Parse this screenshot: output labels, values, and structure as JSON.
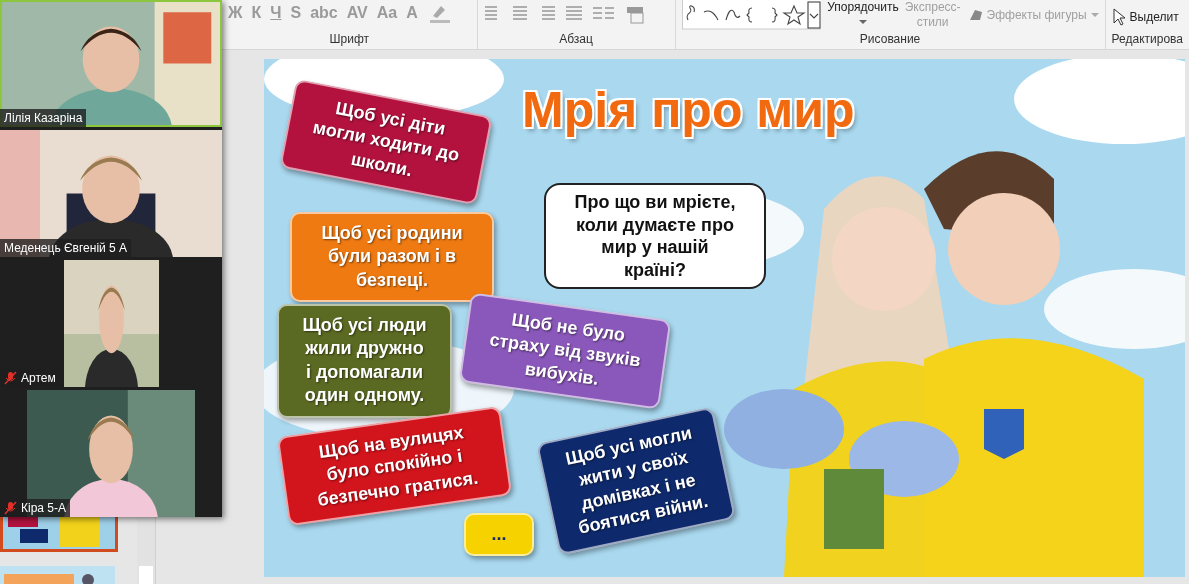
{
  "ribbon": {
    "font_tools": [
      "Ж",
      "К",
      "Ч",
      "S",
      "abc",
      "AV",
      "Aa",
      "A"
    ],
    "font_label": "Шрифт",
    "paragraph_label": "Абзац",
    "arrange_button": "Упорядочить",
    "quick_styles": [
      "Экспресс-",
      "стили"
    ],
    "shape_effects": "Эффекты фигуры",
    "drawing_label": "Рисование",
    "select_button": "Выделит",
    "editing_label": "Редактирова"
  },
  "video_call": {
    "participants": [
      {
        "name": "Лілія Казаріна",
        "muted": false,
        "speaking": true
      },
      {
        "name": "Меденець Євгеній 5 А",
        "muted": false,
        "speaking": false
      },
      {
        "name": "Артем",
        "muted": true,
        "speaking": false
      },
      {
        "name": "Кіра 5-А",
        "muted": true,
        "speaking": false
      }
    ]
  },
  "slide": {
    "title": "Мрія про мир",
    "question": [
      "Про що ви мрієте,",
      "коли думаєте про",
      "мир у нашій",
      "країні?"
    ],
    "cards": [
      {
        "lines": [
          "Щоб усі діти",
          "могли ходити до",
          "школи."
        ],
        "color": "#b3123e"
      },
      {
        "lines": [
          "Щоб усі родини",
          "були разом і в",
          "безпеці."
        ],
        "color": "#ef7a12"
      },
      {
        "lines": [
          "Щоб усі люди",
          "жили дружно",
          "і допомагали",
          "один одному."
        ],
        "color": "#5b6a22"
      },
      {
        "lines": [
          "Щоб не було",
          "страху від звуків",
          "вибухів."
        ],
        "color": "#8a58ba"
      },
      {
        "lines": [
          "Щоб на вулицях",
          "було спокійно і",
          "безпечно гратися."
        ],
        "color": "#d2141c"
      },
      {
        "lines": [
          "..."
        ],
        "color": "#f6d200"
      },
      {
        "lines": [
          "Щоб усі могли",
          "жити у своїх",
          "домівках і не",
          "боятися війни."
        ],
        "color": "#0e2a6c"
      }
    ]
  }
}
